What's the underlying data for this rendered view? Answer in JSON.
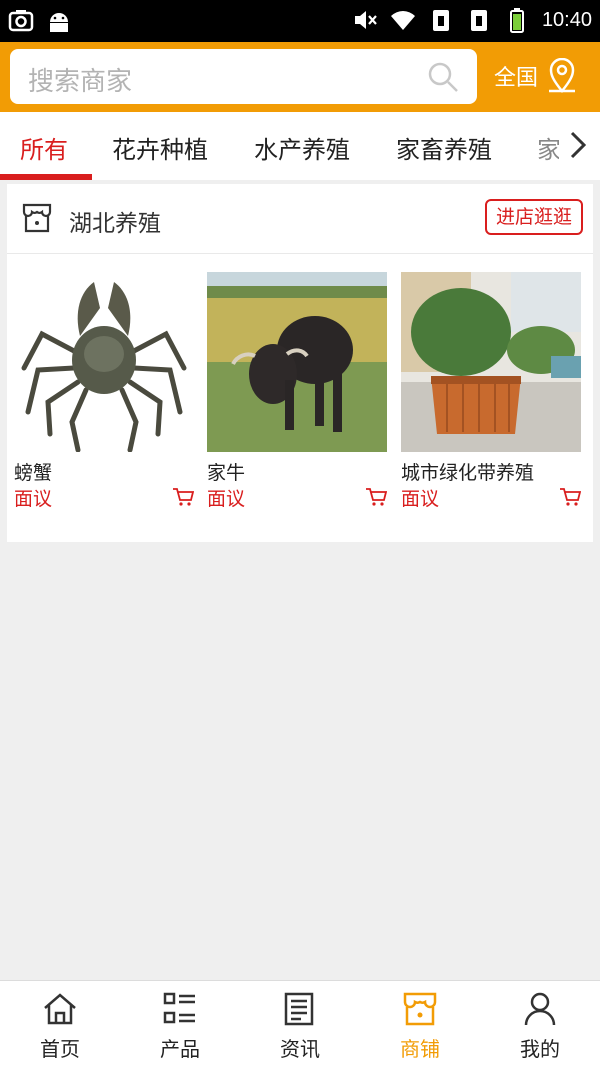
{
  "status_bar": {
    "time": "10:40"
  },
  "search": {
    "placeholder": "搜索商家"
  },
  "region": {
    "label": "全国"
  },
  "tabs": [
    {
      "label": "所有",
      "active": true
    },
    {
      "label": "花卉种植"
    },
    {
      "label": "水产养殖"
    },
    {
      "label": "家畜养殖"
    },
    {
      "label": "家"
    }
  ],
  "shop": {
    "name": "湖北养殖",
    "visit_label": "进店逛逛",
    "products": [
      {
        "name": "螃蟹",
        "price": "面议"
      },
      {
        "name": "家牛",
        "price": "面议"
      },
      {
        "name": "城市绿化带养殖",
        "price": "面议"
      }
    ]
  },
  "bottom_nav": [
    {
      "label": "首页",
      "icon": "home-icon"
    },
    {
      "label": "产品",
      "icon": "list-icon"
    },
    {
      "label": "资讯",
      "icon": "news-icon"
    },
    {
      "label": "商铺",
      "icon": "store-icon",
      "active": true
    },
    {
      "label": "我的",
      "icon": "user-icon"
    }
  ],
  "colors": {
    "accent": "#f29c05",
    "red": "#d91e1e"
  }
}
